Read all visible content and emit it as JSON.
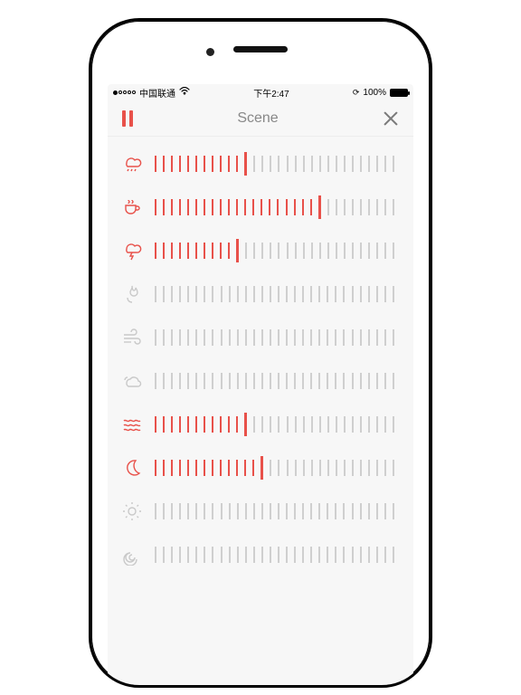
{
  "statusbar": {
    "carrier": "中国联通",
    "time": "下午2:47",
    "battery_pct": "100%"
  },
  "navbar": {
    "title": "Scene"
  },
  "slider": {
    "total_ticks": 30
  },
  "sounds": [
    {
      "id": "rain",
      "icon": "rain",
      "active": true,
      "value": 11
    },
    {
      "id": "coffee",
      "icon": "coffee",
      "active": true,
      "value": 20
    },
    {
      "id": "thunder",
      "icon": "thunder",
      "active": true,
      "value": 10
    },
    {
      "id": "fire",
      "icon": "fire",
      "active": false,
      "value": 0
    },
    {
      "id": "wind",
      "icon": "wind",
      "active": false,
      "value": 0
    },
    {
      "id": "clouds",
      "icon": "clouds",
      "active": false,
      "value": 0
    },
    {
      "id": "waves",
      "icon": "waves",
      "active": true,
      "value": 11
    },
    {
      "id": "moon",
      "icon": "moon",
      "active": true,
      "value": 13
    },
    {
      "id": "sun",
      "icon": "sun",
      "active": false,
      "value": 0
    },
    {
      "id": "spiral",
      "icon": "spiral",
      "active": false,
      "value": 0
    }
  ],
  "colors": {
    "accent": "#e8514a",
    "inactive": "#c9c9c9"
  }
}
